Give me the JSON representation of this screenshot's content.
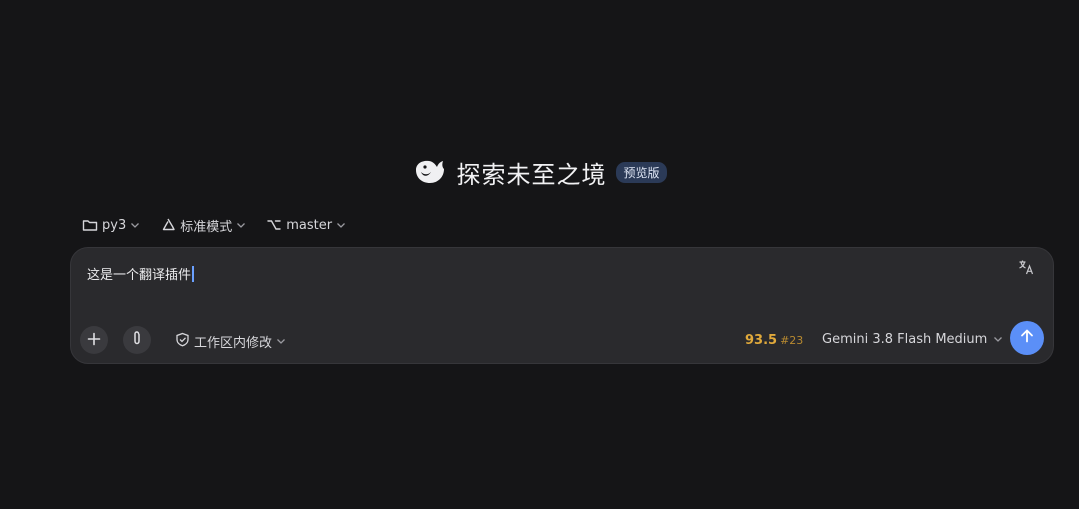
{
  "hero": {
    "title": "探索未至之境",
    "badge": "预览版"
  },
  "toolbar": {
    "folder_label": "py3",
    "mode_label": "标准模式",
    "branch_label": "master"
  },
  "composer": {
    "input_value": "这是一个翻译插件",
    "scope_label": "工作区内修改",
    "score_value": "93.5",
    "score_rank": "#23",
    "model_label": "Gemini 3.8 Flash Medium"
  },
  "colors": {
    "background": "#151517",
    "panel": "#2a2a2d",
    "accent": "#5b8ff7",
    "score": "#e0a93b",
    "badge_bg": "#2b3a57"
  },
  "icons": {
    "logo": "whale-logo-icon",
    "folder": "folder-icon",
    "mode": "recycle-icon",
    "branch": "branch-icon",
    "translate": "translate-icon",
    "plus": "plus-icon",
    "attach": "paperclip-icon",
    "shield": "shield-check-icon",
    "send": "arrow-up-icon",
    "chevron": "chevron-down-icon"
  }
}
